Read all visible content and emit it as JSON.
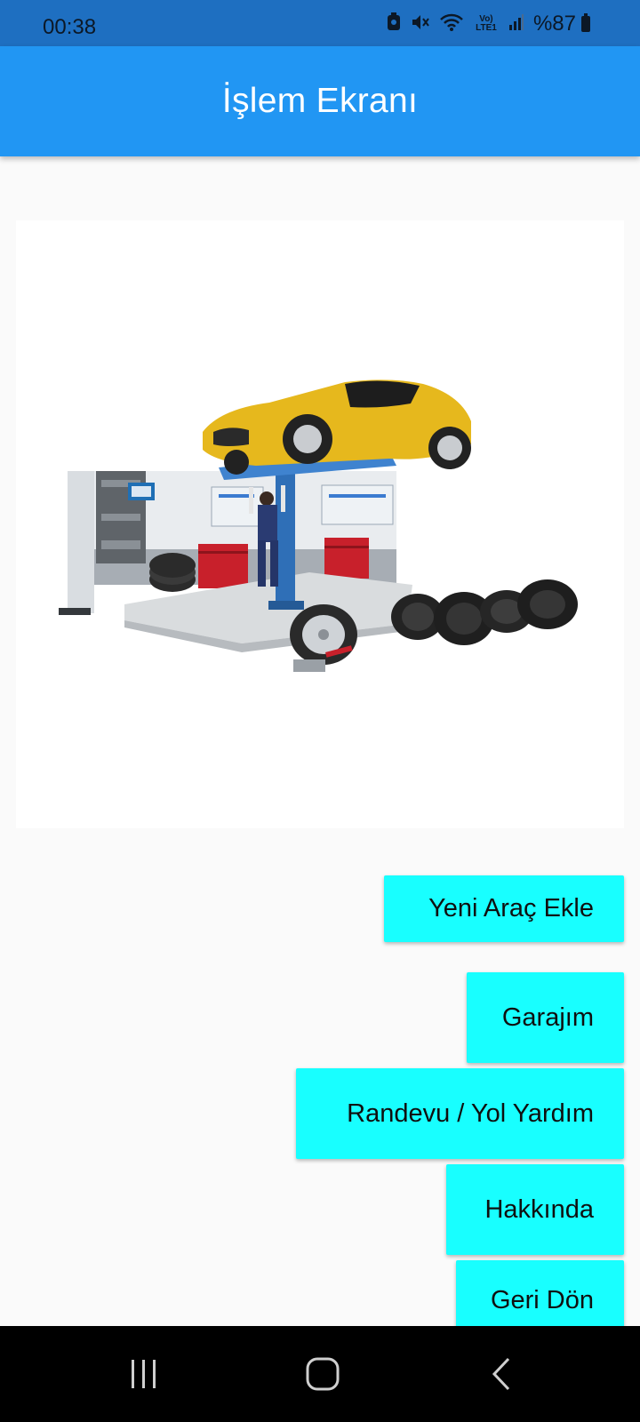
{
  "status_bar": {
    "time": "00:38",
    "battery_text": "%87",
    "network_label": "Vo) LTE1",
    "icons": [
      "notification-icon",
      "vibrate-mute-icon",
      "wifi-icon",
      "volte-icon",
      "signal-icon",
      "battery-icon"
    ]
  },
  "app_bar": {
    "title": "İşlem Ekranı",
    "color": "#2196f3"
  },
  "hero_image": {
    "description_icon": "car-garage-lift-image"
  },
  "menu": {
    "button_color": "#18ffff",
    "buttons": [
      {
        "label": "Yeni Araç Ekle"
      },
      {
        "label": "Garajım"
      },
      {
        "label": "Randevu / Yol Yardım"
      },
      {
        "label": "Hakkında"
      },
      {
        "label": "Geri Dön"
      }
    ]
  },
  "nav_bar": {
    "icons": [
      "recent-apps-icon",
      "home-icon",
      "back-icon"
    ]
  }
}
